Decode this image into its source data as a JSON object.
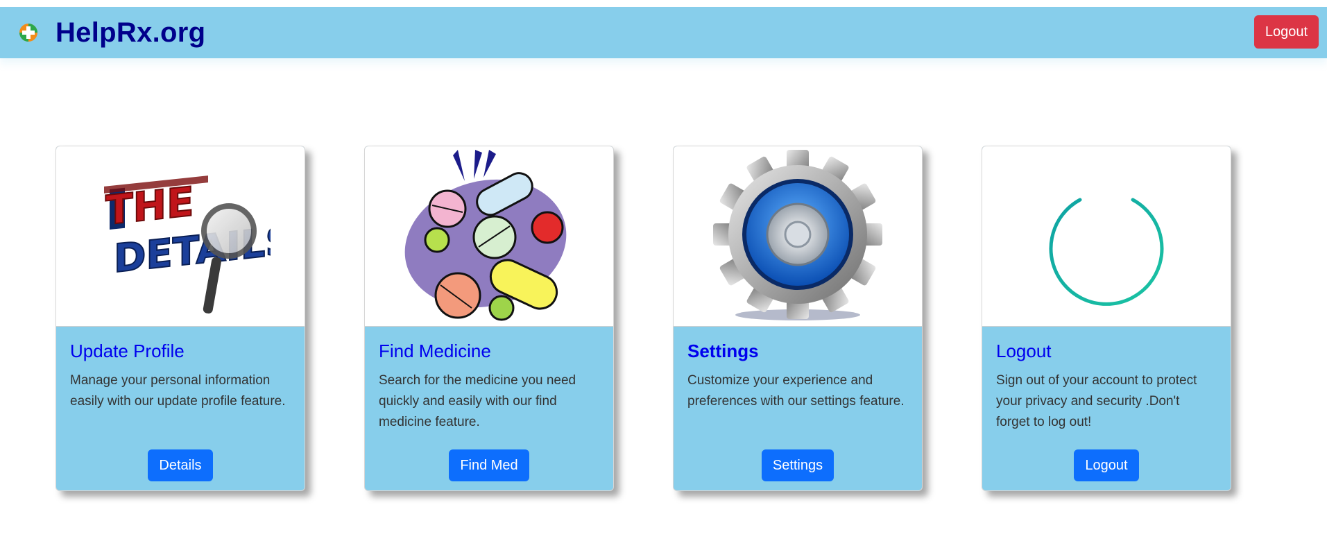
{
  "header": {
    "brand": "HelpRx.org",
    "logout_label": "Logout"
  },
  "cards": [
    {
      "title": "Update Profile",
      "image_alt": "THE DETAILS",
      "text": "Manage your personal information easily with our update profile feature.",
      "button": "Details"
    },
    {
      "title": "Find Medicine",
      "image_alt": "pills-illustration",
      "text": "Search for the medicine you need quickly and easily with our find medicine feature.",
      "button": "Find Med"
    },
    {
      "title": "Settings",
      "image_alt": "gear-illustration",
      "text": "Customize your experience and preferences with our settings feature.",
      "button": "Settings"
    },
    {
      "title": "Logout",
      "image_alt": "power-icon",
      "text": "Sign out of your account to protect your privacy and security .Don't forget to log out!",
      "button": "Logout"
    }
  ],
  "colors": {
    "navbar": "#87ceeb",
    "brand": "#00008b",
    "logout_button": "#dc3545",
    "primary_button": "#0d6efd",
    "card_title": "#0000ee",
    "power_icon": "#14b8a6"
  }
}
